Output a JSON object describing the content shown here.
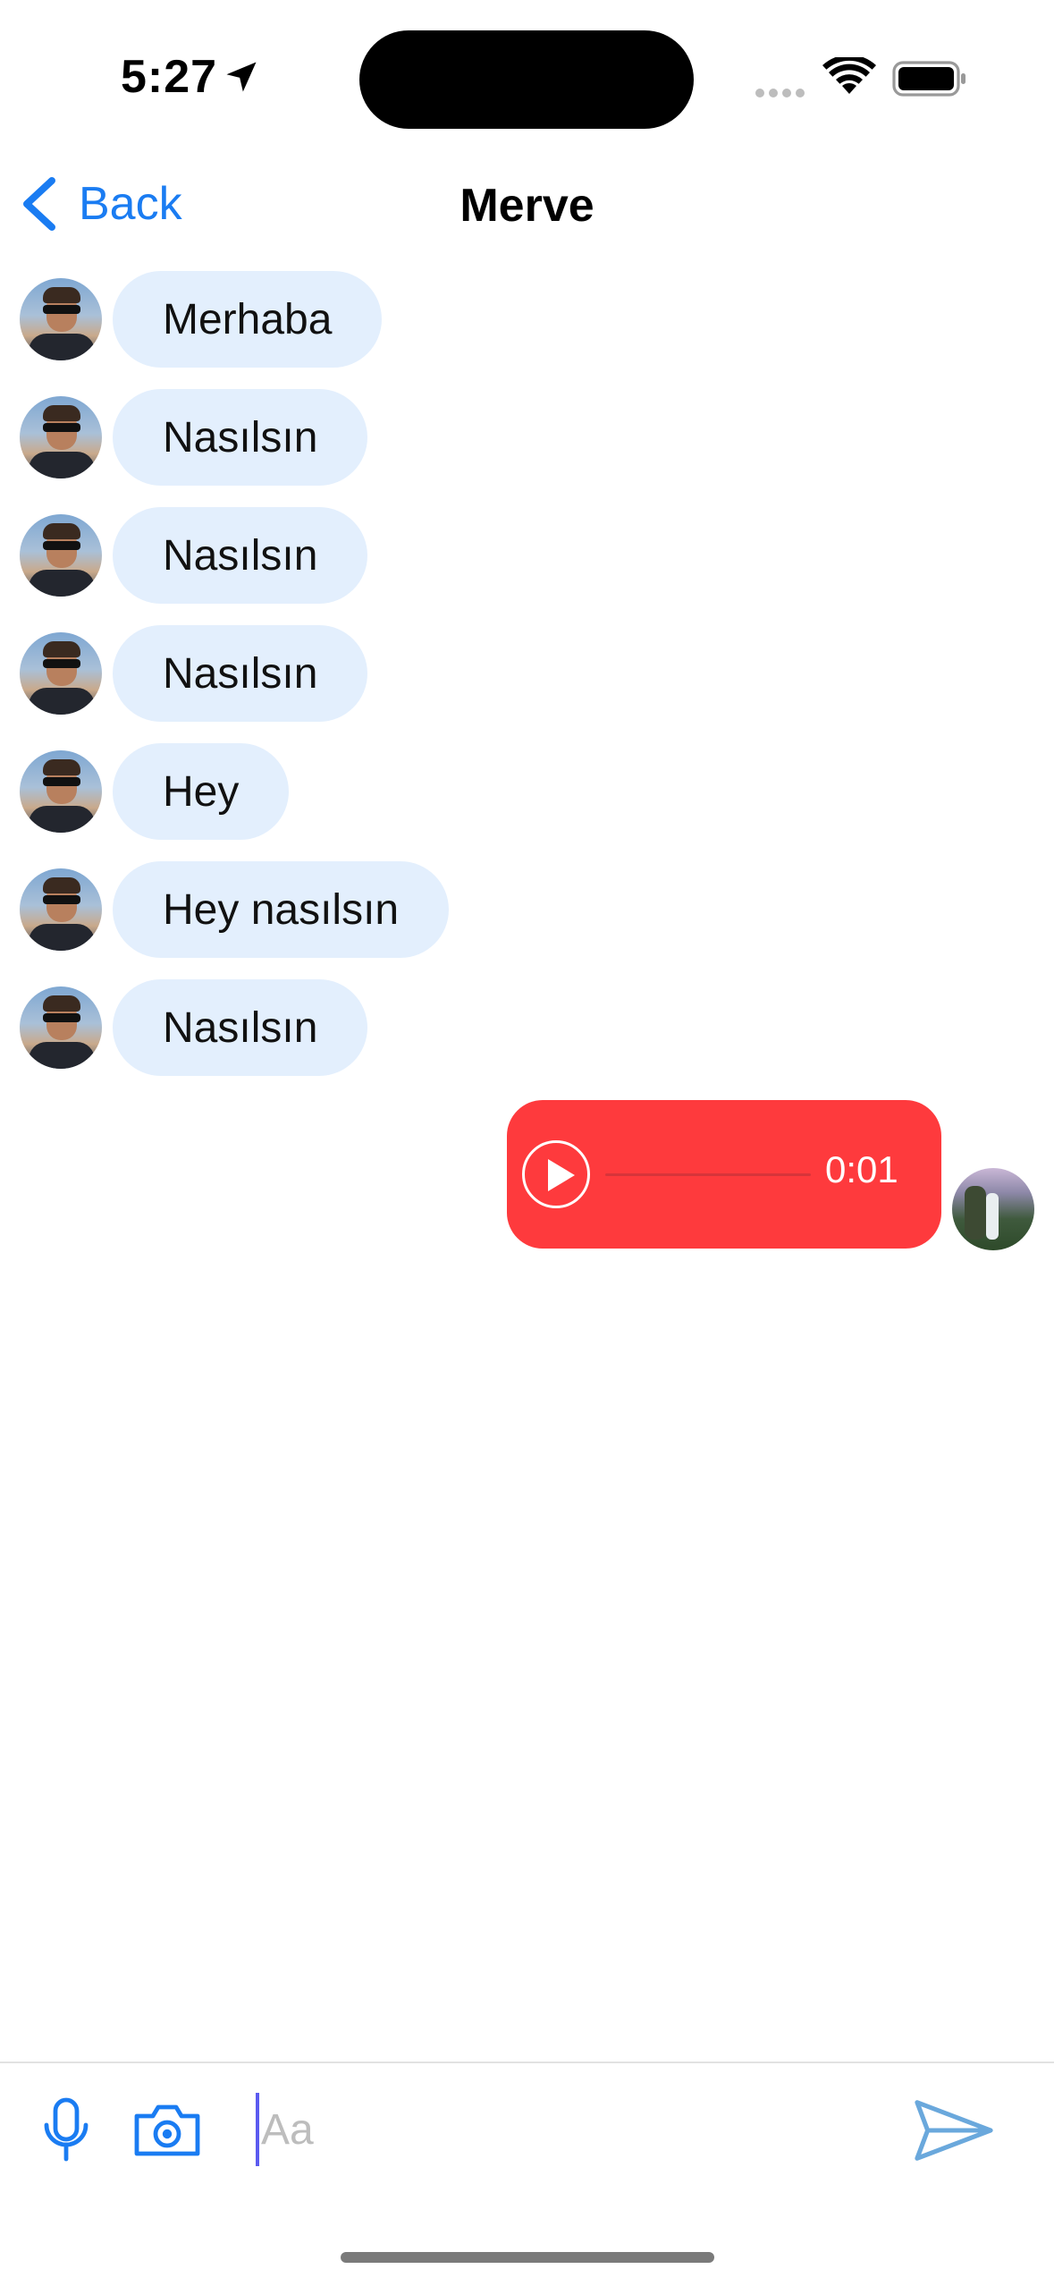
{
  "status_bar": {
    "time": "5:27"
  },
  "nav": {
    "back_label": "Back",
    "title": "Merve"
  },
  "messages": [
    {
      "text": "Merhaba"
    },
    {
      "text": "Nasılsın"
    },
    {
      "text": "Nasılsın"
    },
    {
      "text": "Nasılsın"
    },
    {
      "text": "Hey"
    },
    {
      "text": "Hey nasılsın"
    },
    {
      "text": "Nasılsın"
    }
  ],
  "voice_message": {
    "duration": "0:01",
    "color": "#fe3a3d"
  },
  "input": {
    "placeholder": "Aa"
  },
  "colors": {
    "accent": "#1a7cf2",
    "incoming_bubble": "#e3effd"
  },
  "icons": {
    "back": "chevron-left-icon",
    "mic": "mic-icon",
    "camera": "camera-icon",
    "send": "send-icon",
    "play": "play-icon"
  }
}
